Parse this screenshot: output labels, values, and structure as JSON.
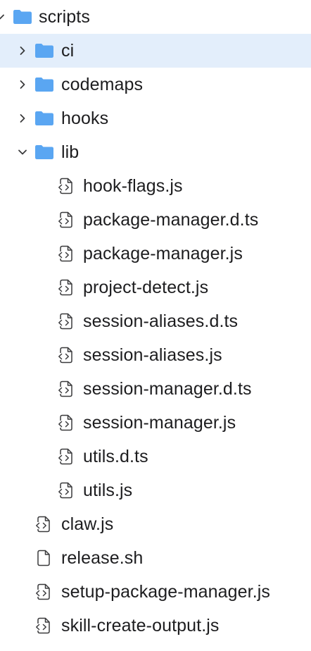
{
  "explorer": {
    "colors": {
      "selected_bg": "#e3eefb",
      "folder": "#5aa6f2",
      "chevron": "#3a3a3c",
      "file_icon": "#3a3a3c"
    },
    "items": [
      {
        "label": "scripts",
        "type": "folder",
        "expanded": true,
        "depth": 0
      },
      {
        "label": "ci",
        "type": "folder",
        "expanded": false,
        "depth": 1,
        "selected": true
      },
      {
        "label": "codemaps",
        "type": "folder",
        "expanded": false,
        "depth": 1
      },
      {
        "label": "hooks",
        "type": "folder",
        "expanded": false,
        "depth": 1
      },
      {
        "label": "lib",
        "type": "folder",
        "expanded": true,
        "depth": 1
      },
      {
        "label": "hook-flags.js",
        "type": "code-file",
        "depth": 2
      },
      {
        "label": "package-manager.d.ts",
        "type": "code-file",
        "depth": 2
      },
      {
        "label": "package-manager.js",
        "type": "code-file",
        "depth": 2
      },
      {
        "label": "project-detect.js",
        "type": "code-file",
        "depth": 2
      },
      {
        "label": "session-aliases.d.ts",
        "type": "code-file",
        "depth": 2
      },
      {
        "label": "session-aliases.js",
        "type": "code-file",
        "depth": 2
      },
      {
        "label": "session-manager.d.ts",
        "type": "code-file",
        "depth": 2
      },
      {
        "label": "session-manager.js",
        "type": "code-file",
        "depth": 2
      },
      {
        "label": "utils.d.ts",
        "type": "code-file",
        "depth": 2
      },
      {
        "label": "utils.js",
        "type": "code-file",
        "depth": 2
      },
      {
        "label": "claw.js",
        "type": "code-file",
        "depth": 1
      },
      {
        "label": "release.sh",
        "type": "plain-file",
        "depth": 1
      },
      {
        "label": "setup-package-manager.js",
        "type": "code-file",
        "depth": 1
      },
      {
        "label": "skill-create-output.js",
        "type": "code-file",
        "depth": 1
      }
    ]
  }
}
